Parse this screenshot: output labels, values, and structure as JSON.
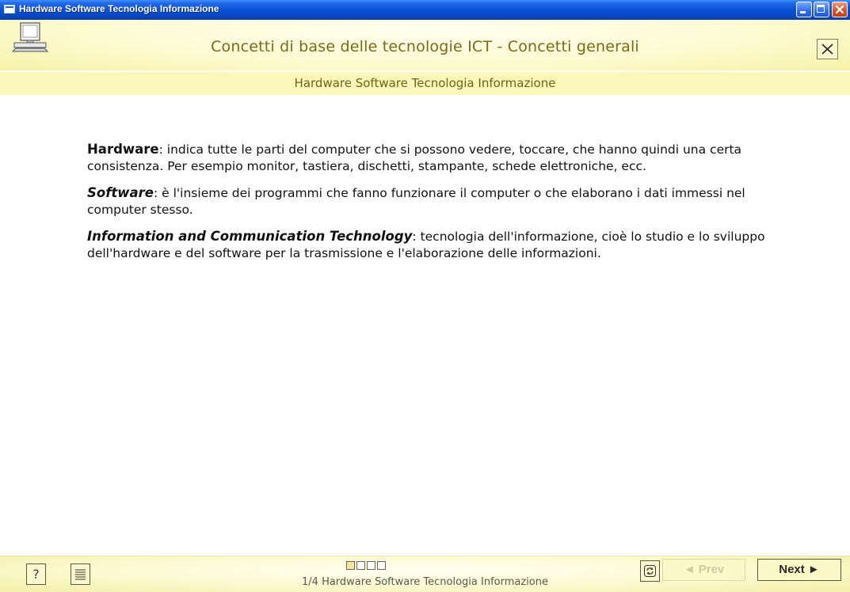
{
  "window": {
    "title": "Hardware Software Tecnologia Informazione",
    "accent": "#0a4fd6"
  },
  "header": {
    "course_title": "Concetti di base delle tecnologie ICT - Concetti generali",
    "page_title": "Hardware Software Tecnologia Informazione",
    "icon": "computer-icon",
    "background": "#fcf9c4"
  },
  "content": {
    "paragraphs": [
      {
        "term": "Hardware",
        "rest": ": indica tutte le parti del computer che si possono vedere, toccare, che hanno quindi una certa consistenza. Per esempio monitor, tastiera, dischetti, stampante, schede elettroniche, ecc."
      },
      {
        "term": "Software",
        "rest": ": è l'insieme dei programmi che fanno funzionare il computer o che elaborano i dati immessi nel computer stesso."
      },
      {
        "term": "Information and Communication Technology",
        "rest": ": tecnologia dell'informazione, cioè lo studio e lo sviluppo dell'hardware e del software per la trasmissione e l'elaborazione delle informazioni."
      }
    ]
  },
  "footer": {
    "help_label": "?",
    "page_status": "1/4 Hardware Software Tecnologia Informazione",
    "progress": {
      "current": 1,
      "total": 4
    },
    "prev_label": "◄ Prev",
    "next_label": "Next ►",
    "prev_enabled": false
  }
}
